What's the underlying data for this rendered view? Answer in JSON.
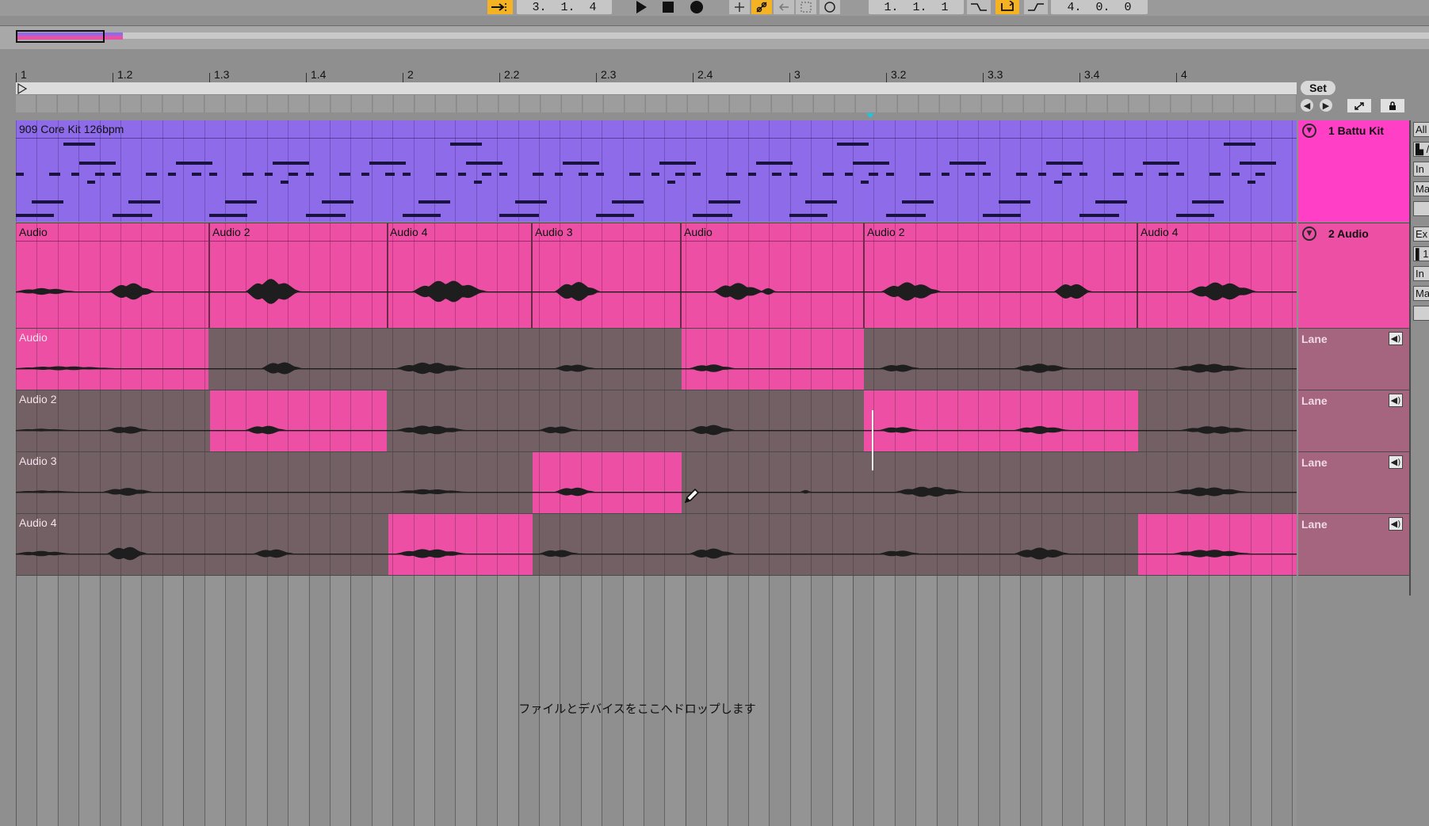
{
  "transport": {
    "position": "3.  1.  4",
    "loop_start": "1.  1.  1",
    "loop_length": "4.  0.  0"
  },
  "icons": [
    "follow-icon",
    "play-icon",
    "stop-icon",
    "record-icon",
    "add-icon",
    "automation-arm-icon",
    "back-to-arrangement-icon",
    "capture-icon",
    "loop-icon",
    "punch-in-icon",
    "loop-switch-icon",
    "punch-out-icon",
    "set-locator-prev-icon",
    "set-locator-next-icon",
    "fold-icon",
    "speaker-icon",
    "pencil-cursor-icon"
  ],
  "ruler": {
    "labels": [
      "1",
      "1.2",
      "1.3",
      "1.4",
      "2",
      "2.2",
      "2.3",
      "2.4",
      "3",
      "3.2",
      "3.3",
      "3.4",
      "4"
    ]
  },
  "locator": {
    "set_label": "Set"
  },
  "tracks": {
    "midi_clip_name": "909 Core Kit 126bpm",
    "audio_main_clips": [
      "Audio",
      "Audio 2",
      "Audio 4",
      "Audio 3",
      "Audio",
      "Audio 2",
      "Audio 4"
    ],
    "lanes": [
      {
        "name": "Audio"
      },
      {
        "name": "Audio 2"
      },
      {
        "name": "Audio 3"
      },
      {
        "name": "Audio 4"
      }
    ]
  },
  "headers": {
    "track1": "1 Battu Kit",
    "track2": "2 Audio",
    "lane_label": "Lane"
  },
  "device_strip": [
    "All",
    "▙ /",
    "In",
    "Ma",
    "",
    "Ex",
    "▌1",
    "In",
    "Ma",
    ""
  ],
  "drop_hint": "ファイルとデバイスをここへドロップします",
  "colors": {
    "midi": "#8d6be9",
    "audio": "#ec4fa3",
    "lane_inactive": "#726064",
    "header_pink": "#ff3fc6",
    "lane_header": "#a5657f",
    "transport_accent": "#f5b324",
    "locator_marker": "#17c7e3"
  }
}
